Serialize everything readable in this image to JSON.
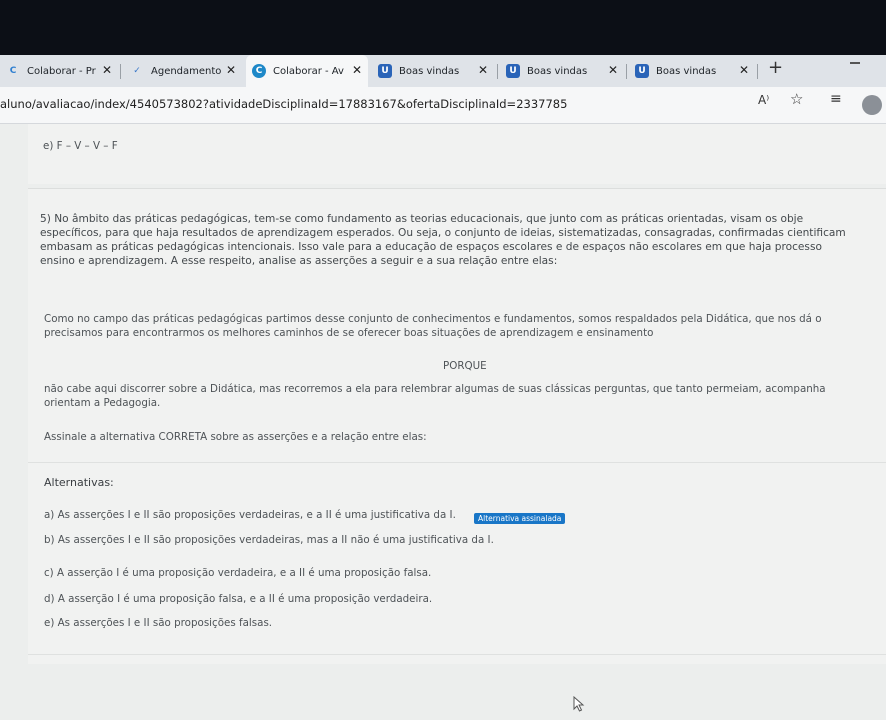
{
  "browser": {
    "tabs": [
      {
        "label": "Colaborar - Pr",
        "icon": "C"
      },
      {
        "label": "Agendamento",
        "icon": "✓"
      },
      {
        "label": "Colaborar - Av",
        "icon": "C"
      },
      {
        "label": "Boas vindas",
        "icon": "U"
      },
      {
        "label": "Boas vindas",
        "icon": "U"
      },
      {
        "label": "Boas vindas",
        "icon": "U"
      }
    ],
    "close_glyph": "✕",
    "new_tab_glyph": "+",
    "url": "aluno/avaliacao/index/4540573802?atividadeDisciplinaId=17883167&ofertaDisciplinaId=2337785",
    "read_aloud_glyph": "A⁾",
    "favorite_glyph": "☆",
    "favorites_list_glyph": "≡"
  },
  "previous_question": {
    "option_e": "e)  F – V – V – F"
  },
  "question": {
    "lines": [
      "5)  No âmbito das práticas pedagógicas, tem-se como fundamento as teorias educacionais, que junto com as práticas orientadas, visam os obje",
      "específicos, para que haja resultados de aprendizagem esperados. Ou seja, o conjunto de ideias, sistematizadas, consagradas, confirmadas cientificam",
      "embasam as práticas pedagógicas intencionais. Isso vale para a educação de espaços escolares e de espaços não escolares em que haja processo",
      "ensino e aprendizagem. A esse respeito, analise as asserções a seguir e a sua relação entre elas:"
    ],
    "assertion_1": [
      "Como no campo das práticas pedagógicas partimos desse conjunto de conhecimentos e fundamentos, somos respaldados pela Didática, que nos dá o",
      "precisamos para encontrarmos os melhores caminhos de se oferecer boas situações de aprendizagem e ensinamento"
    ],
    "porque": "PORQUE",
    "assertion_2": [
      "não cabe aqui discorrer sobre a Didática, mas recorremos a ela para relembrar algumas de suas clássicas perguntas, que tanto permeiam, acompanha",
      "orientam a Pedagogia."
    ],
    "instruction": "Assinale a alternativa CORRETA sobre as asserções e a relação entre elas:"
  },
  "alternatives": {
    "heading": "Alternativas:",
    "items": [
      "a)  As asserções I e II são proposições verdadeiras, e a II é uma justificativa da I.",
      "b)  As asserções I e II são proposições verdadeiras, mas a II não é uma justificativa da I.",
      "c)  A asserção I é uma proposição verdadeira, e a II é uma proposição falsa.",
      "d)  A asserção I é uma proposição falsa, e a II é uma proposição verdadeira.",
      "e)  As asserções I e II são proposições falsas."
    ],
    "selected_badge": "Alternativa assinalada"
  }
}
